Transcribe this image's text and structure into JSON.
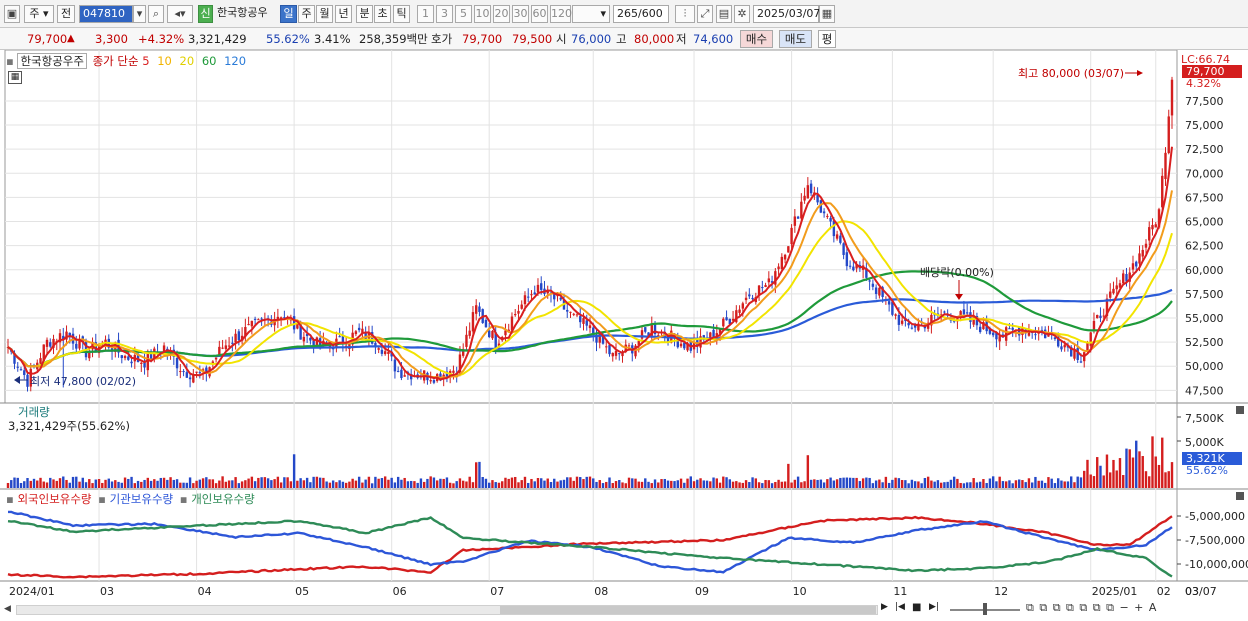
{
  "toolbar": {
    "market": "주",
    "prefix": "전",
    "code": "047810",
    "badge": "신",
    "stock_name": "한국항공우",
    "periods": [
      "일",
      "주",
      "월",
      "년",
      "분",
      "초",
      "틱"
    ],
    "active_period": "일",
    "intervals": [
      "1",
      "3",
      "5",
      "10",
      "20",
      "30",
      "60",
      "120"
    ],
    "count_display": "265",
    "count_max": "/600",
    "date": "2025/03/07"
  },
  "quote": {
    "price": "79,700",
    "arrow": "▲",
    "change": "3,300",
    "change_pct": "+4.32%",
    "volume": "3,321,429",
    "vol_ratio": "55.62%",
    "turnover": "3.41%",
    "amount": "258,359백만",
    "hoga_label": "호가",
    "ask": "79,700",
    "bid": "79,500",
    "open_label": "시",
    "open": "76,000",
    "high_label": "고",
    "high": "80,000",
    "low_label": "저",
    "low": "74,600",
    "buy_label": "매수",
    "sell_label": "매도",
    "eval_label": "평"
  },
  "price_legend": {
    "name": "한국항공우주",
    "ma_label": "종가 단순",
    "ma": [
      {
        "period": "5",
        "color": "#d91f1f"
      },
      {
        "period": "10",
        "color": "#f29c1c"
      },
      {
        "period": "20",
        "color": "#f2e400"
      },
      {
        "period": "60",
        "color": "#1f9a3a"
      },
      {
        "period": "120",
        "color": "#2a5bd8"
      }
    ]
  },
  "annotations": {
    "max_label": "최고 80,000 (03/07)",
    "min_label": "최저 47,800 (02/02)",
    "dividend_label": "배당락(0.00%)",
    "lc_label": "LC:66.74",
    "last_price_tag": "79,700",
    "last_change_tag": "4.32%"
  },
  "volume_panel": {
    "title": "거래량",
    "value": "3,321,429주(55.62%)",
    "last_tag": "3,321K",
    "last_pct": "55.62%"
  },
  "holding_panel": {
    "legend": [
      {
        "label": "외국인보유수량",
        "color": "#d41e1e"
      },
      {
        "label": "기관보유수량",
        "color": "#2d56d8"
      },
      {
        "label": "개인보유수량",
        "color": "#2e8b57"
      }
    ]
  },
  "colors": {
    "up": "#d41e1e",
    "down": "#2448c8",
    "grid": "#e3e3e3"
  },
  "chart_data": [
    {
      "type": "candlestick",
      "title": "",
      "ylim": [
        46500,
        80500
      ],
      "y_ticks": [
        47500,
        50000,
        52500,
        55000,
        57500,
        60000,
        62500,
        65000,
        67500,
        70000,
        72500,
        75000,
        77500
      ],
      "y_tick_labels": [
        "47,500",
        "50,000",
        "52,500",
        "55,000",
        "57,500",
        "60,000",
        "62,500",
        "65,000",
        "67,500",
        "70,000",
        "72,500",
        "75,000",
        "77,500"
      ],
      "x_labels": [
        "2024/01",
        "03",
        "04",
        "05",
        "06",
        "07",
        "08",
        "09",
        "10",
        "11",
        "12",
        "2025/01",
        "02",
        "03",
        "03/07"
      ],
      "close_keypoints": [
        [
          0,
          52000
        ],
        [
          6,
          48500
        ],
        [
          12,
          52500
        ],
        [
          18,
          53500
        ],
        [
          24,
          51500
        ],
        [
          30,
          52500
        ],
        [
          36,
          51000
        ],
        [
          42,
          50500
        ],
        [
          48,
          52000
        ],
        [
          54,
          49500
        ],
        [
          60,
          49000
        ],
        [
          66,
          52000
        ],
        [
          72,
          53500
        ],
        [
          78,
          54500
        ],
        [
          84,
          55500
        ],
        [
          90,
          53500
        ],
        [
          96,
          52000
        ],
        [
          102,
          52500
        ],
        [
          108,
          53500
        ],
        [
          114,
          52500
        ],
        [
          120,
          49500
        ],
        [
          126,
          49200
        ],
        [
          132,
          49000
        ],
        [
          138,
          49800
        ],
        [
          144,
          56000
        ],
        [
          150,
          52500
        ],
        [
          156,
          55500
        ],
        [
          162,
          58000
        ],
        [
          168,
          57000
        ],
        [
          174,
          55000
        ],
        [
          180,
          53500
        ],
        [
          186,
          51000
        ],
        [
          192,
          52000
        ],
        [
          198,
          54000
        ],
        [
          204,
          53000
        ],
        [
          210,
          52000
        ],
        [
          216,
          53000
        ],
        [
          222,
          55000
        ],
        [
          228,
          57500
        ],
        [
          234,
          58500
        ],
        [
          240,
          63000
        ],
        [
          246,
          69000
        ],
        [
          252,
          65000
        ],
        [
          258,
          61000
        ],
        [
          264,
          59500
        ],
        [
          270,
          56500
        ],
        [
          276,
          54000
        ],
        [
          282,
          54500
        ],
        [
          288,
          55500
        ],
        [
          294,
          55000
        ],
        [
          300,
          54000
        ],
        [
          306,
          53200
        ],
        [
          312,
          54000
        ],
        [
          318,
          53500
        ],
        [
          324,
          52500
        ],
        [
          330,
          51000
        ],
        [
          336,
          55500
        ],
        [
          342,
          58500
        ],
        [
          348,
          61500
        ],
        [
          354,
          66000
        ],
        [
          358,
          79700
        ]
      ],
      "ma_windows": [
        5,
        10,
        20,
        60,
        120
      ]
    },
    {
      "type": "bar",
      "title": "거래량",
      "ylim": [
        0,
        10000000
      ],
      "y_tick_labels": [
        "7,500K",
        "5,000K"
      ],
      "last_value": 3321429
    },
    {
      "type": "line",
      "title": "",
      "y_tick_labels": [
        "-5,000,000",
        "-7,500,000",
        "-10,000,000"
      ],
      "series": [
        {
          "name": "외국인보유수량",
          "keypoints": [
            [
              0,
              0.93
            ],
            [
              20,
              0.96
            ],
            [
              60,
              0.92
            ],
            [
              90,
              0.86
            ],
            [
              110,
              0.83
            ],
            [
              130,
              0.9
            ],
            [
              140,
              0.62
            ],
            [
              180,
              0.53
            ],
            [
              220,
              0.49
            ],
            [
              250,
              0.24
            ],
            [
              280,
              0.2
            ],
            [
              300,
              0.28
            ],
            [
              320,
              0.4
            ],
            [
              335,
              0.55
            ],
            [
              345,
              0.55
            ],
            [
              358,
              0.18
            ]
          ]
        },
        {
          "name": "기관보유수량",
          "keypoints": [
            [
              0,
              0.12
            ],
            [
              20,
              0.3
            ],
            [
              45,
              0.28
            ],
            [
              70,
              0.45
            ],
            [
              90,
              0.4
            ],
            [
              110,
              0.58
            ],
            [
              130,
              0.8
            ],
            [
              140,
              0.76
            ],
            [
              160,
              0.5
            ],
            [
              180,
              0.58
            ],
            [
              200,
              0.82
            ],
            [
              220,
              0.9
            ],
            [
              240,
              0.46
            ],
            [
              260,
              0.52
            ],
            [
              280,
              0.36
            ],
            [
              300,
              0.25
            ],
            [
              320,
              0.47
            ],
            [
              335,
              0.62
            ],
            [
              350,
              0.55
            ],
            [
              358,
              0.32
            ]
          ]
        },
        {
          "name": "개인보유수량",
          "keypoints": [
            [
              0,
              0.24
            ],
            [
              20,
              0.38
            ],
            [
              60,
              0.3
            ],
            [
              90,
              0.24
            ],
            [
              110,
              0.4
            ],
            [
              130,
              0.2
            ],
            [
              140,
              0.46
            ],
            [
              180,
              0.58
            ],
            [
              220,
              0.72
            ],
            [
              250,
              0.8
            ],
            [
              280,
              0.88
            ],
            [
              300,
              0.85
            ],
            [
              320,
              0.77
            ],
            [
              335,
              0.6
            ],
            [
              350,
              0.72
            ],
            [
              358,
              0.96
            ]
          ]
        }
      ]
    }
  ]
}
